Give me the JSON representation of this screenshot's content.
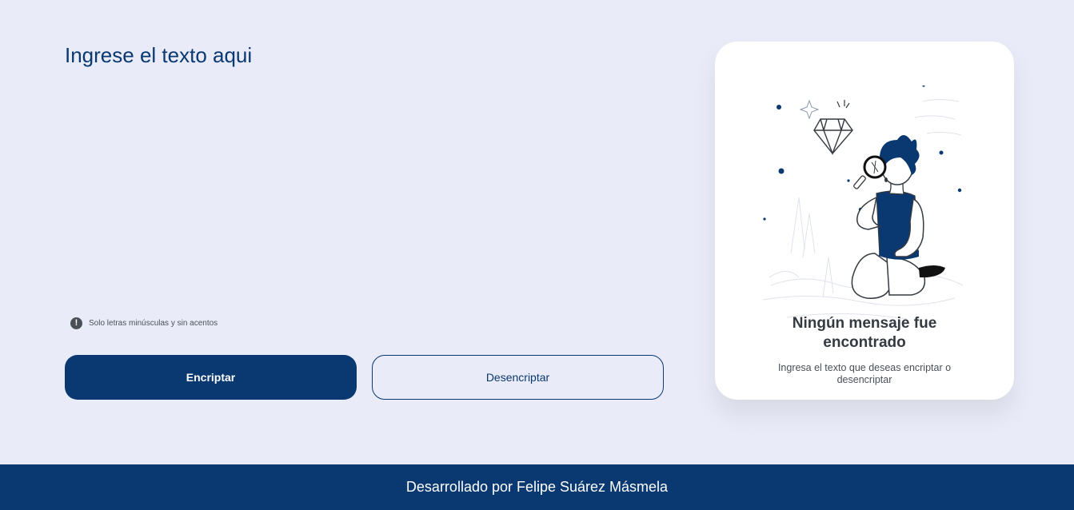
{
  "input": {
    "placeholder": "Ingrese el texto aqui",
    "value": ""
  },
  "hint": {
    "icon": "exclamation-icon",
    "text": "Solo letras minúsculas y sin acentos"
  },
  "buttons": {
    "encrypt_label": "Encriptar",
    "decrypt_label": "Desencriptar"
  },
  "result_panel": {
    "title": "Ningún mensaje fue encontrado",
    "subtitle": "Ingresa el texto que deseas encriptar o desencriptar",
    "illustration": "person-with-magnifying-glass-illustration"
  },
  "footer": {
    "text": "Desarrollado por Felipe Suárez Másmela"
  },
  "colors": {
    "background": "#e9ecf8",
    "primary": "#0a3871",
    "card": "#ffffff",
    "text_dark": "#343a40",
    "text_muted": "#495057"
  }
}
